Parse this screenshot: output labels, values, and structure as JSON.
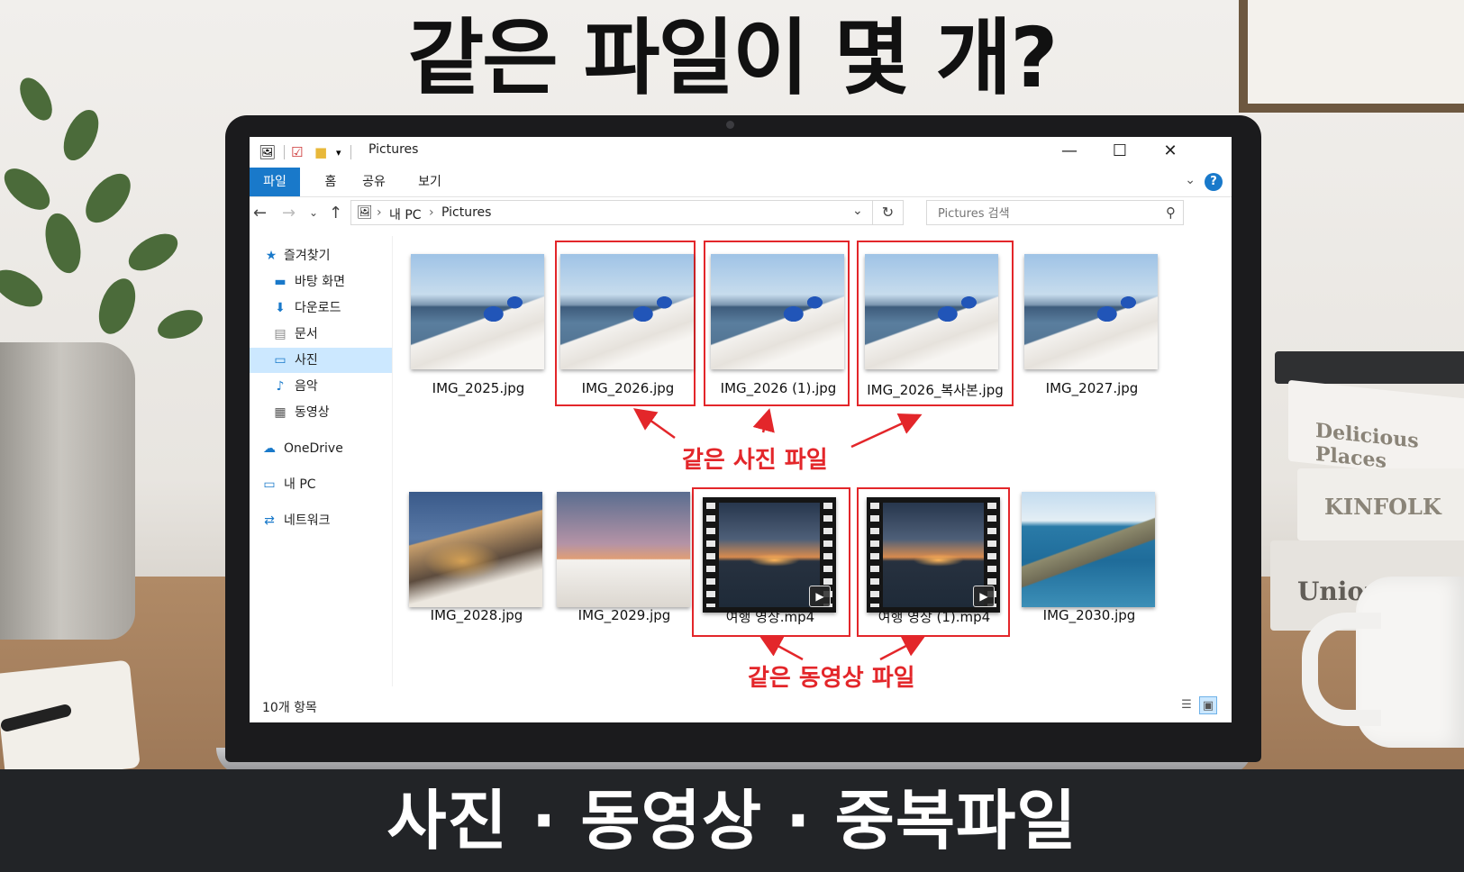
{
  "headline": "같은 파일이 몇 개?",
  "bottom_banner": "사진 · 동영상 · 중복파일",
  "books": [
    "Delicious Places",
    "KINFOLK",
    "Union"
  ],
  "window": {
    "title": "Pictures",
    "controls": {
      "minimize": "—",
      "maximize": "☐",
      "close": "✕"
    }
  },
  "ribbon": {
    "tabs": [
      {
        "label": "파일",
        "active": true
      },
      {
        "label": "홈"
      },
      {
        "label": "공유"
      },
      {
        "label": "보기"
      }
    ],
    "help": "?"
  },
  "address": {
    "path": [
      "내 PC",
      "Pictures"
    ],
    "search_placeholder": "Pictures 검색"
  },
  "sidebar": {
    "items": [
      {
        "label": "즐겨찾기",
        "icon": "star-icon"
      },
      {
        "label": "바탕 화면",
        "icon": "desktop-icon"
      },
      {
        "label": "다운로드",
        "icon": "download-icon"
      },
      {
        "label": "문서",
        "icon": "document-icon"
      },
      {
        "label": "사진",
        "icon": "pictures-icon",
        "selected": true
      },
      {
        "label": "음악",
        "icon": "music-icon"
      },
      {
        "label": "동영상",
        "icon": "video-icon"
      },
      {
        "label": "OneDrive",
        "icon": "cloud-icon"
      },
      {
        "label": "내 PC",
        "icon": "pc-icon"
      },
      {
        "label": "네트워크",
        "icon": "network-icon"
      }
    ]
  },
  "files": [
    {
      "name": "IMG_2025.jpg",
      "kind": "santorini"
    },
    {
      "name": "IMG_2026.jpg",
      "kind": "santorini",
      "highlighted": true
    },
    {
      "name": "IMG_2026 (1).jpg",
      "kind": "santorini",
      "highlighted": true
    },
    {
      "name": "IMG_2026_복사본.jpg",
      "kind": "santorini",
      "highlighted": true
    },
    {
      "name": "IMG_2027.jpg",
      "kind": "santorini"
    },
    {
      "name": "IMG_2028.jpg",
      "kind": "night"
    },
    {
      "name": "IMG_2029.jpg",
      "kind": "windmill"
    },
    {
      "name": "여행 영상.mp4",
      "kind": "video",
      "highlighted": true
    },
    {
      "name": "여행 영상 (1).mp4",
      "kind": "video",
      "highlighted": true
    },
    {
      "name": "IMG_2030.jpg",
      "kind": "coast"
    }
  ],
  "annotations": {
    "photos": "같은 사진 파일",
    "videos": "같은 동영상 파일",
    "color": "#e3262a"
  },
  "status": {
    "item_count": "10개 항목"
  },
  "colors": {
    "accent": "#1979ca",
    "selection": "#cce8ff"
  }
}
